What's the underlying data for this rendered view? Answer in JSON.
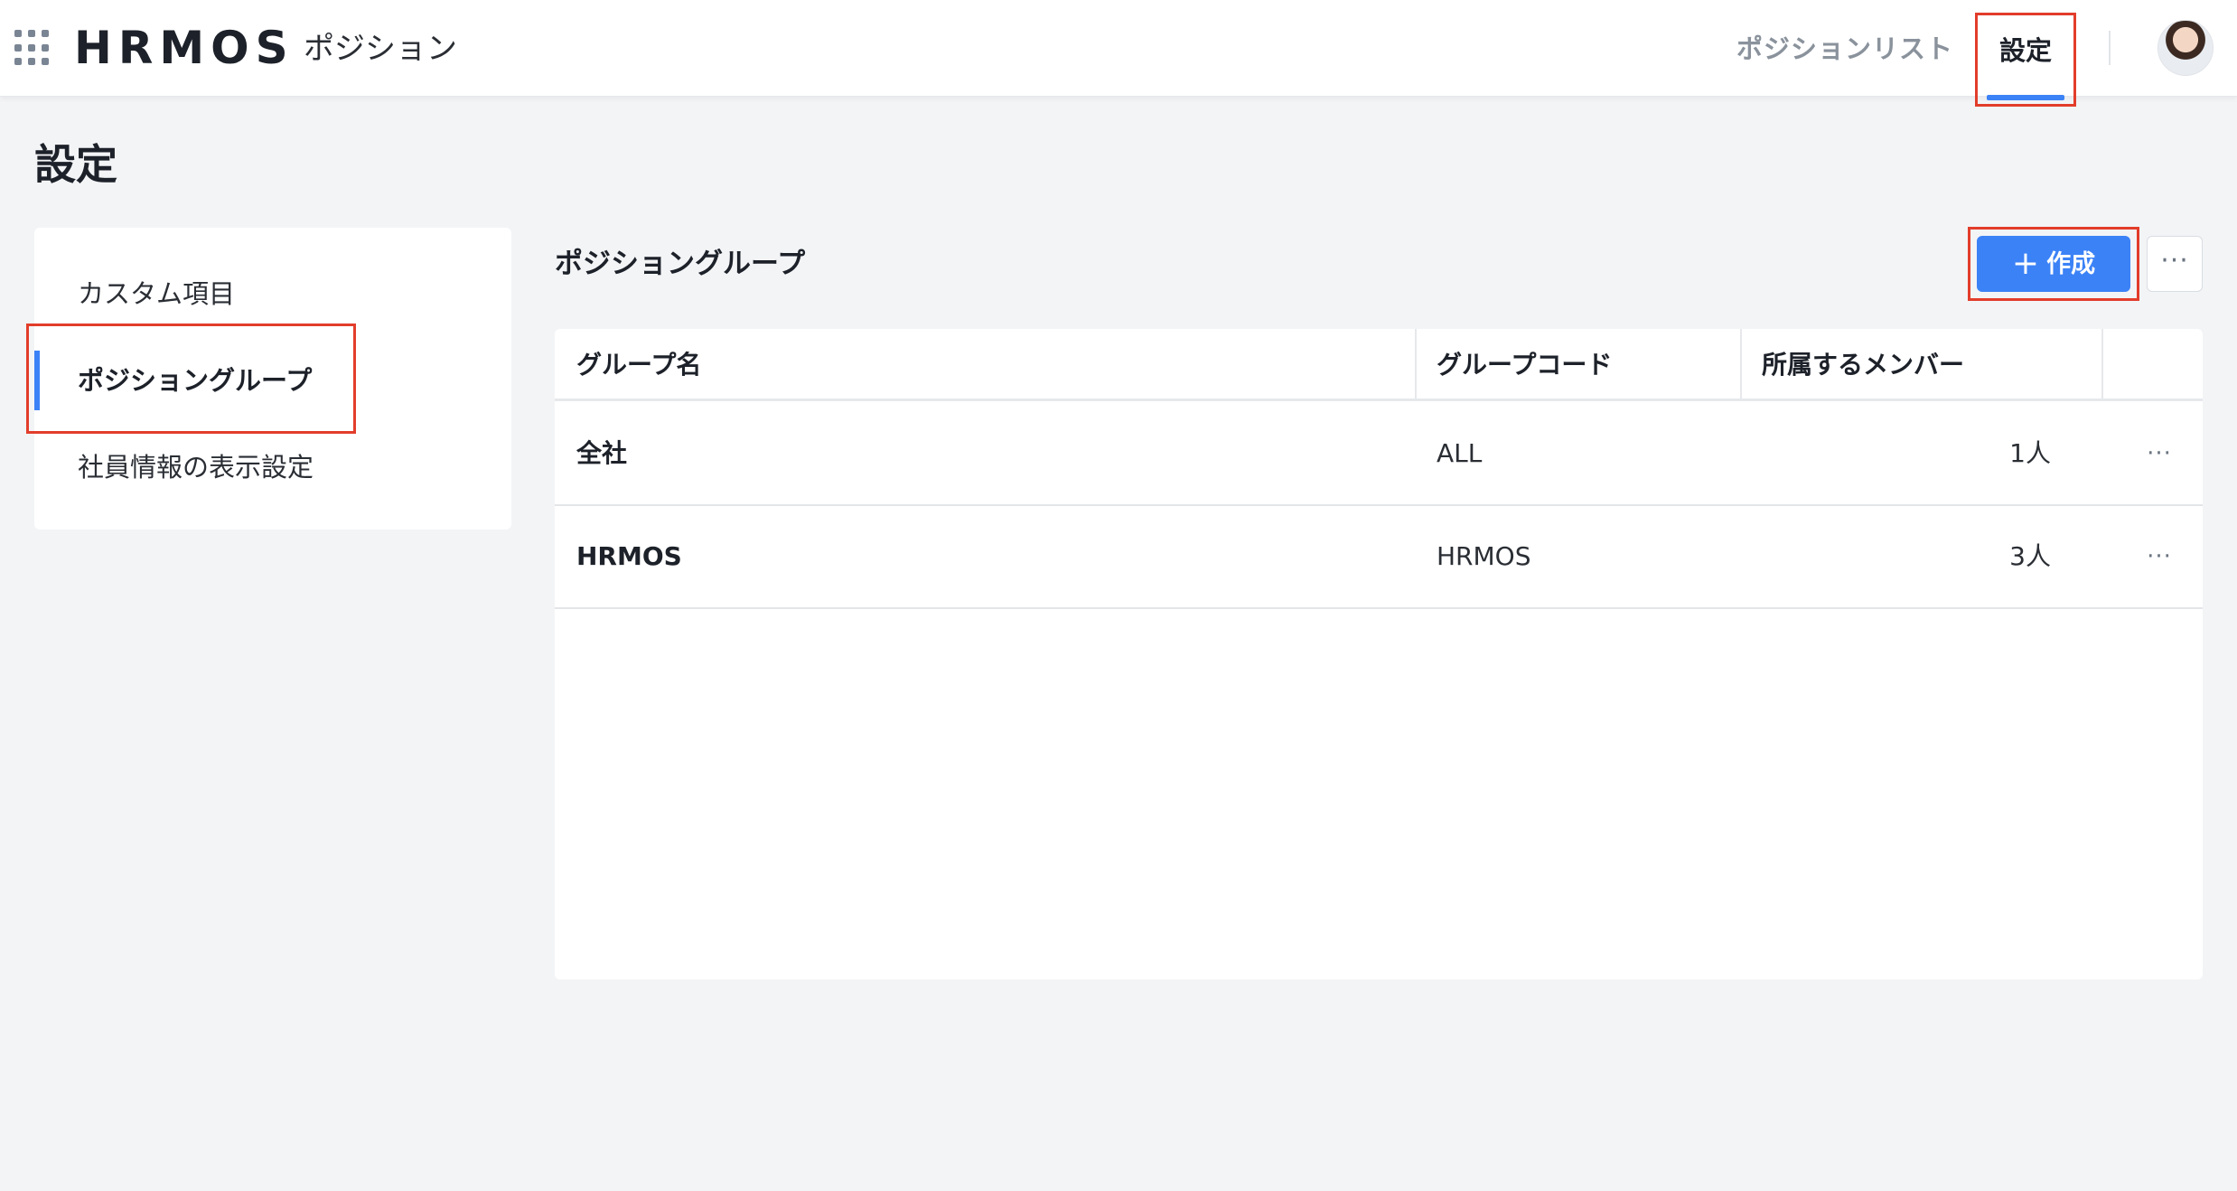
{
  "header": {
    "logo": "HRMOS",
    "product": "ポジション",
    "nav": {
      "list": "ポジションリスト",
      "settings": "設定"
    }
  },
  "page": {
    "title": "設定"
  },
  "sidebar": {
    "items": [
      {
        "label": "カスタム項目"
      },
      {
        "label": "ポジショングループ"
      },
      {
        "label": "社員情報の表示設定"
      }
    ]
  },
  "main": {
    "section_title": "ポジショングループ",
    "create_label": "作成",
    "table": {
      "headers": [
        "グループ名",
        "グループコード",
        "所属するメンバー"
      ],
      "rows": [
        {
          "name": "全社",
          "code": "ALL",
          "members": "1人"
        },
        {
          "name": "HRMOS",
          "code": "HRMOS",
          "members": "3人"
        }
      ]
    }
  },
  "icons": {
    "app_grid": "apps-grid-icon",
    "more": "more-horizontal-icon",
    "plus": "plus-icon",
    "avatar": "user-avatar"
  },
  "colors": {
    "accent": "#3b82f6",
    "highlight": "#e23d2b"
  }
}
